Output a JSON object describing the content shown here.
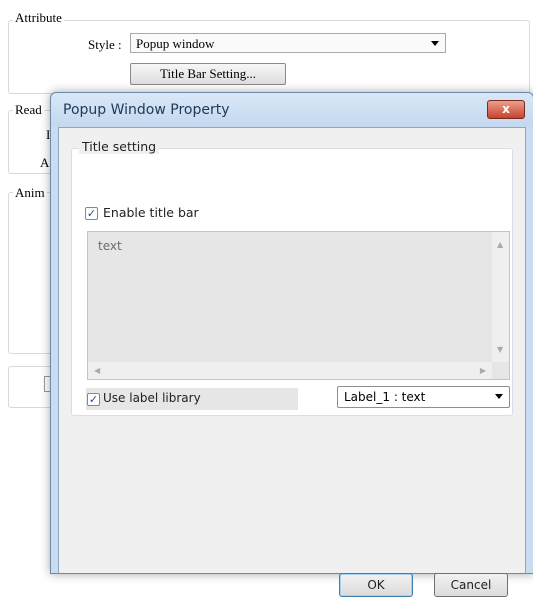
{
  "background": {
    "attribute_legend": "Attribute",
    "style_label": "Style :",
    "style_value": "Popup window",
    "title_bar_button": "Title Bar Setting...",
    "read_legend": "Read",
    "read_frag_1": "I",
    "read_frag_2": "A",
    "anim_legend": "Anim"
  },
  "popup": {
    "title": "Popup Window Property",
    "close_label": "x",
    "title_setting_legend": "Title setting",
    "enable_title_bar_label": "Enable title bar",
    "enable_title_bar_checked": true,
    "text_value": "text",
    "use_label_library_label": "Use label library",
    "use_label_library_checked": true,
    "label_value": "Label_1 : text",
    "ok_label": "OK",
    "cancel_label": "Cancel"
  }
}
